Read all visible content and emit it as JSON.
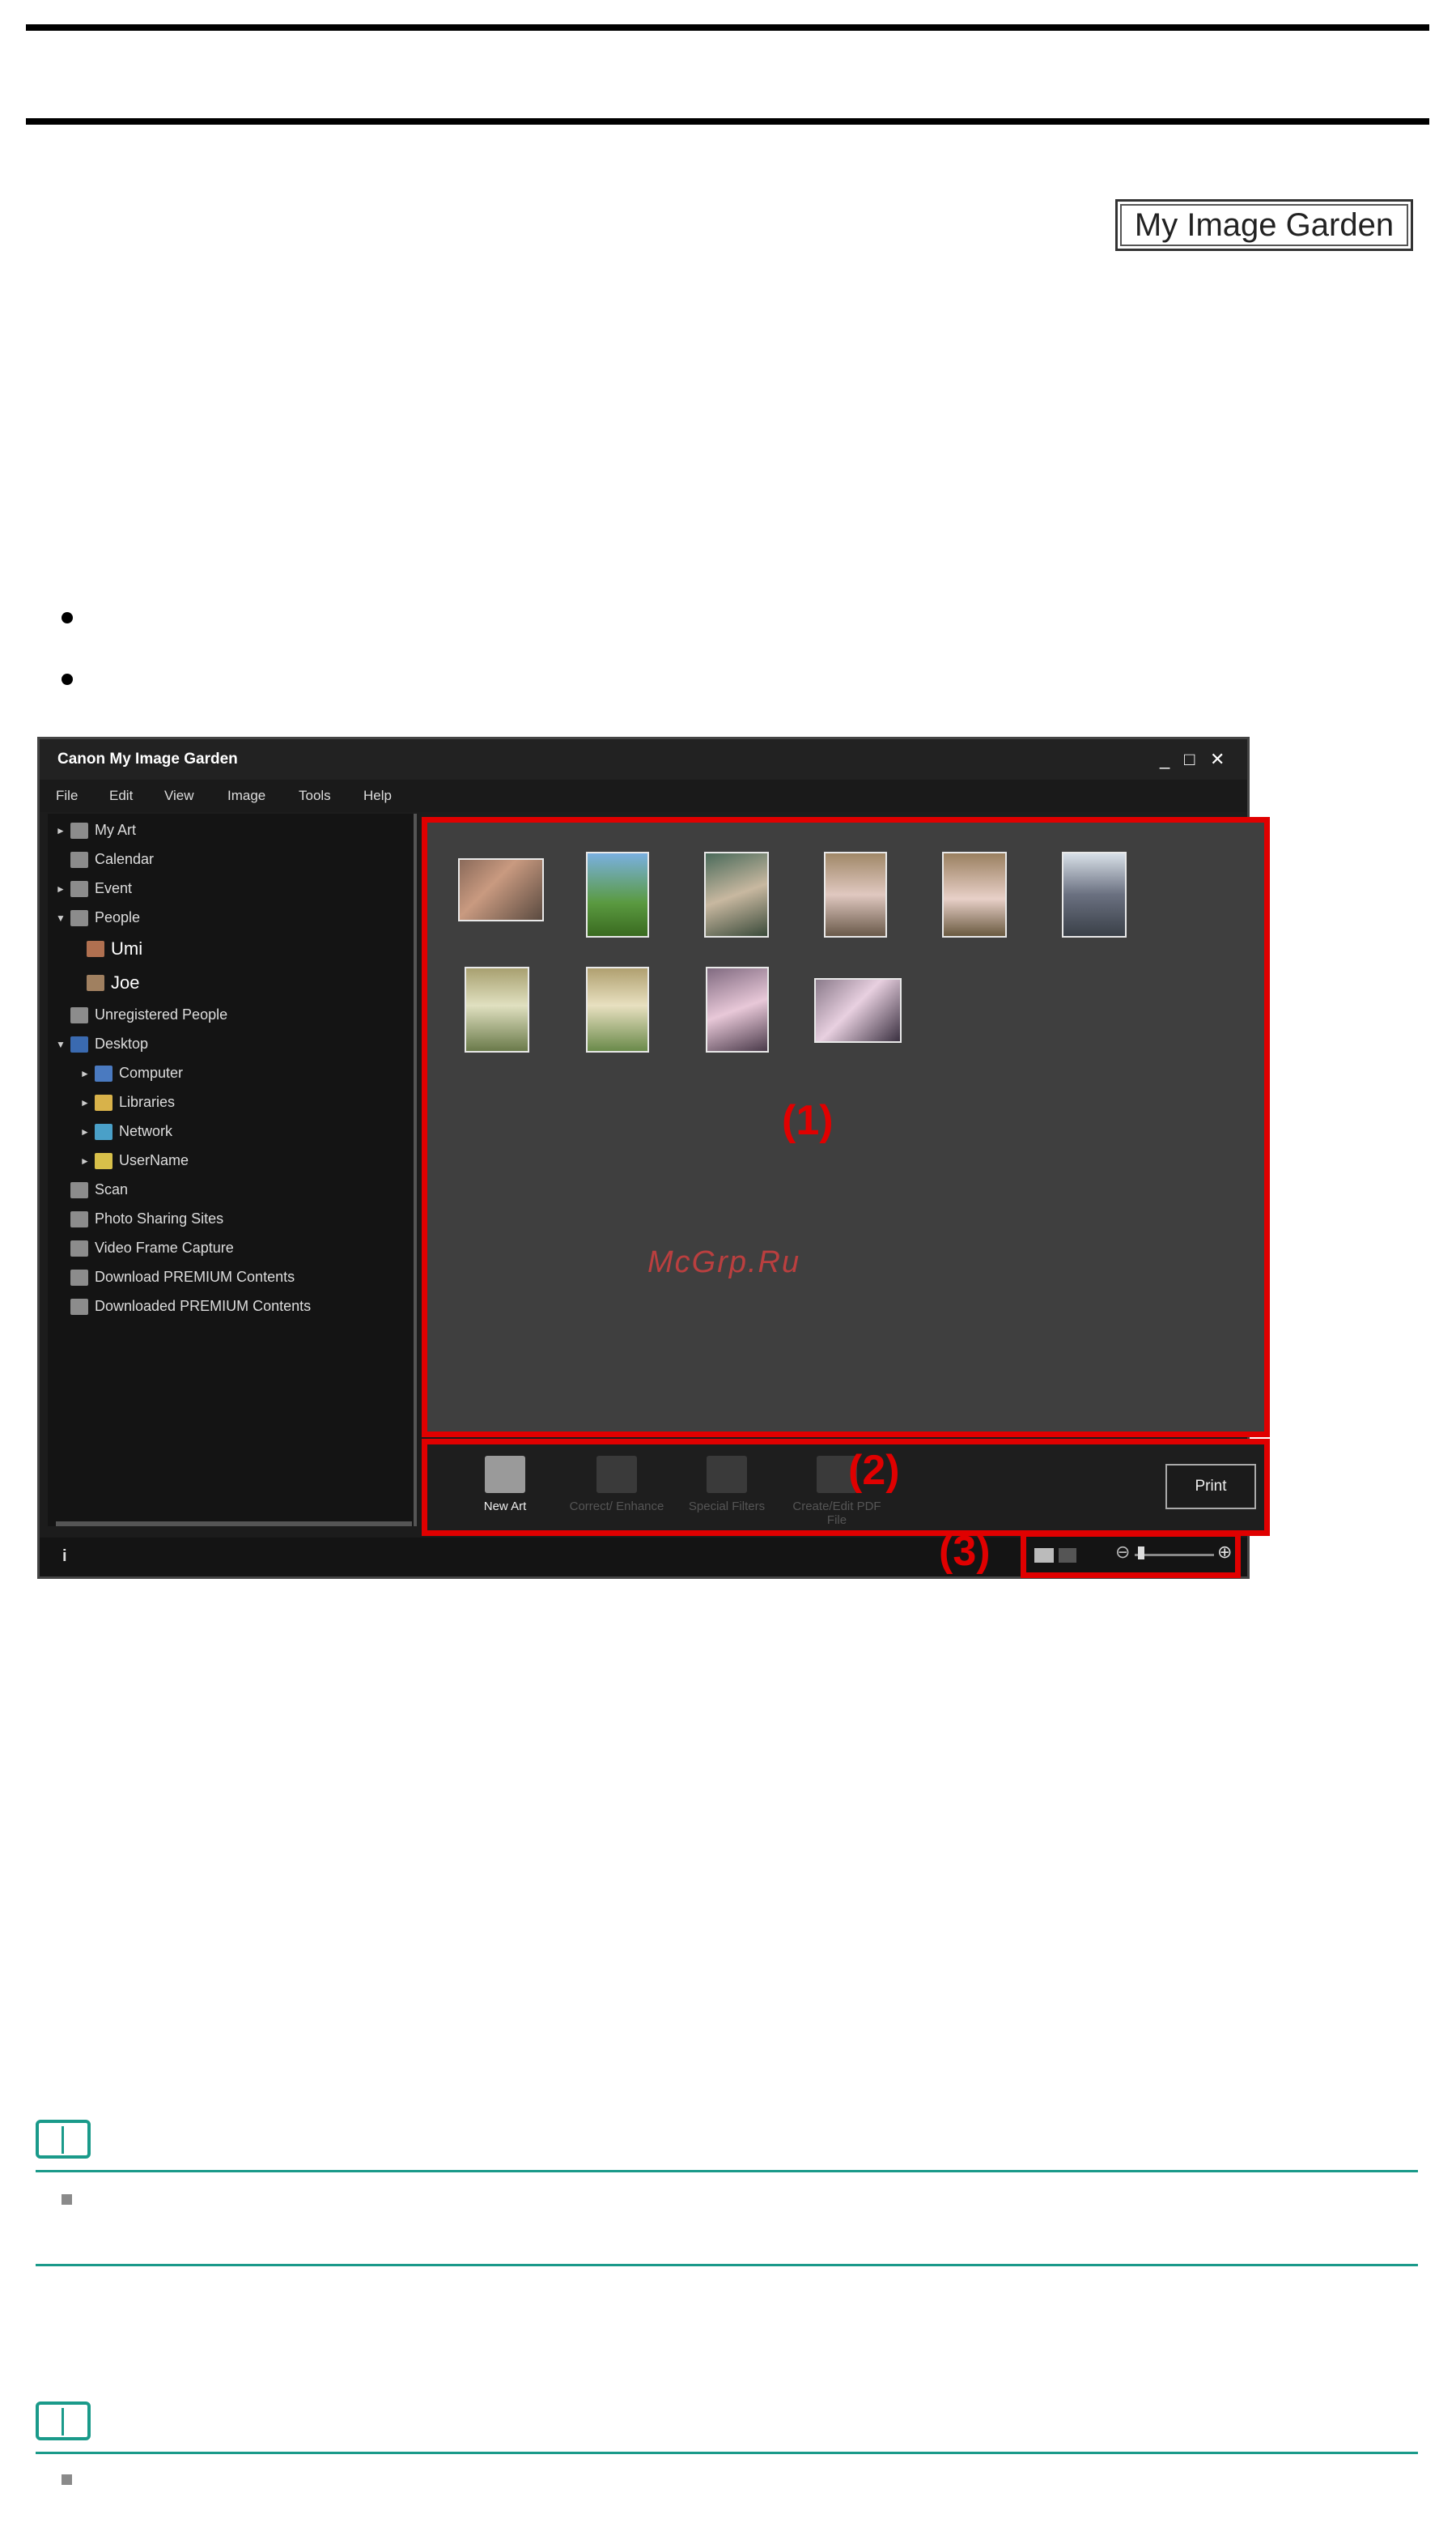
{
  "badge": {
    "label": "My Image Garden"
  },
  "window": {
    "title": "Canon My Image Garden",
    "controls": [
      "_",
      "□",
      "✕"
    ],
    "menu": [
      "File",
      "Edit",
      "View",
      "Image",
      "Tools",
      "Help"
    ],
    "tree": [
      {
        "label": "My Art",
        "arrow": "►",
        "icon": "my-art-icon"
      },
      {
        "label": "Calendar",
        "arrow": "",
        "icon": "calendar-icon"
      },
      {
        "label": "Event",
        "arrow": "►",
        "icon": "event-icon"
      },
      {
        "label": "People",
        "arrow": "▼",
        "icon": "person-icon"
      },
      {
        "label": "Umi",
        "arrow": "",
        "icon": "photo-icon"
      },
      {
        "label": "Joe",
        "arrow": "",
        "icon": "photo-icon"
      },
      {
        "label": "Unregistered People",
        "arrow": "",
        "icon": "person-icon"
      },
      {
        "label": "Desktop",
        "arrow": "▼",
        "icon": "desktop-icon"
      },
      {
        "label": "Computer",
        "arrow": "►",
        "icon": "computer-icon"
      },
      {
        "label": "Libraries",
        "arrow": "►",
        "icon": "folder-icon"
      },
      {
        "label": "Network",
        "arrow": "►",
        "icon": "network-icon"
      },
      {
        "label": "UserName",
        "arrow": "►",
        "icon": "user-folder-icon"
      },
      {
        "label": "Scan",
        "arrow": "",
        "icon": "scan-icon"
      },
      {
        "label": "Photo Sharing Sites",
        "arrow": "",
        "icon": "photo-sharing-icon"
      },
      {
        "label": "Video Frame Capture",
        "arrow": "",
        "icon": "video-icon"
      },
      {
        "label": "Download PREMIUM Contents",
        "arrow": "",
        "icon": "download-icon"
      },
      {
        "label": "Downloaded PREMIUM Contents",
        "arrow": "",
        "icon": "folder-icon"
      }
    ],
    "tools": [
      "New Art",
      "Correct/ Enhance",
      "Special Filters",
      "Create/Edit PDF File"
    ],
    "print_label": "Print",
    "info_glyph": "i",
    "zoom_minus": "⊖",
    "zoom_plus": "⊕"
  },
  "callouts": [
    "(1)",
    "(2)",
    "(3)"
  ],
  "watermark": "McGrp.Ru",
  "colors": {
    "callout_red": "#e00000",
    "note_teal": "#1a9a8a"
  }
}
